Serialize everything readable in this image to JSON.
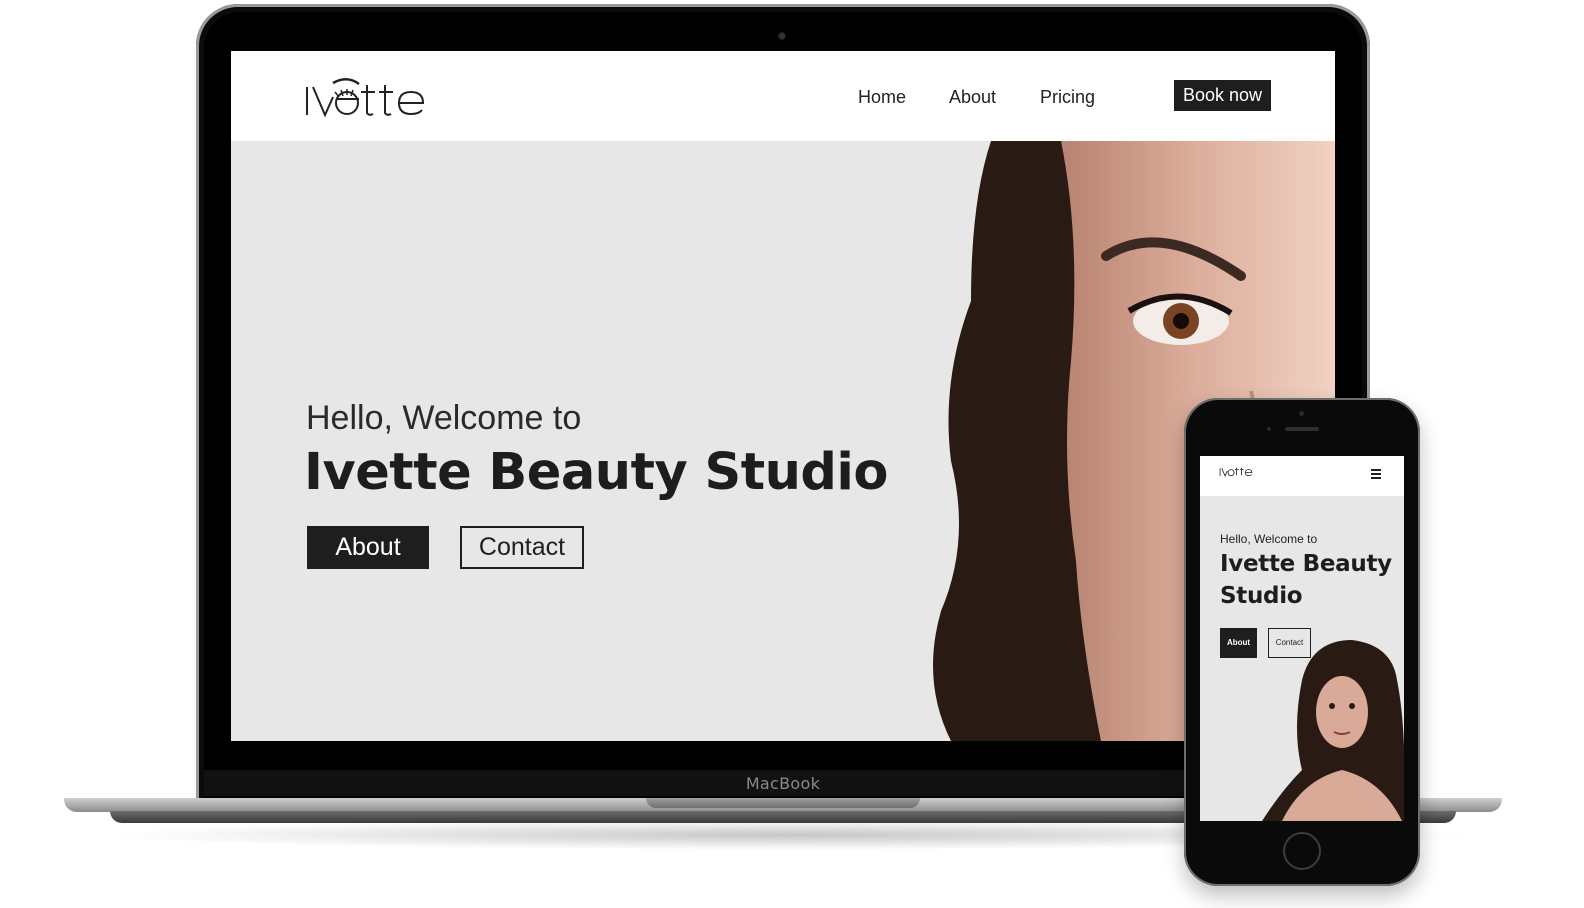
{
  "site": {
    "logo_text": "Ivette",
    "nav": {
      "items": [
        {
          "label": "Home"
        },
        {
          "label": "About"
        },
        {
          "label": "Pricing"
        }
      ],
      "book_label": "Book now"
    },
    "hero": {
      "greeting": "Hello, Welcome to",
      "title": "Ivette Beauty Studio",
      "about_button": "About",
      "contact_button": "Contact"
    }
  },
  "device": {
    "laptop_label": "MacBook"
  },
  "colors": {
    "hero_background": "#e7e7e7",
    "primary_dark": "#1e1e1e",
    "nav_background": "#ffffff"
  }
}
